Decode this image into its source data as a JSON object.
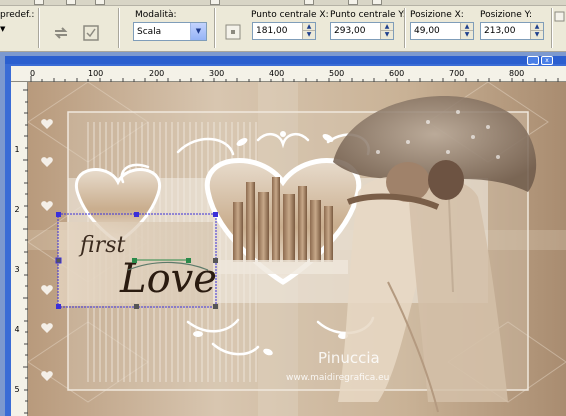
{
  "toolbar": {
    "preset_label": "predef.:",
    "mode_label": "Modalità:",
    "mode_value": "Scala",
    "center_x_label": "Punto centrale X:",
    "center_x_value": "181,00",
    "center_y_label": "Punto centrale Y:",
    "center_y_value": "293,00",
    "pos_x_label": "Posizione X:",
    "pos_x_value": "49,00",
    "pos_y_label": "Posizione Y:",
    "pos_y_value": "213,00"
  },
  "ruler": {
    "top_ticks": [
      "0",
      "100",
      "200",
      "300",
      "400",
      "500",
      "600",
      "700",
      "800"
    ],
    "left_ticks": [
      "1",
      "2",
      "3",
      "4",
      "5"
    ]
  },
  "canvas": {
    "text_first": "first",
    "text_love": "Love",
    "watermark_name": "Pinuccia",
    "watermark_url": "www.maidiregrafica.eu"
  },
  "colors": {
    "selection": "#3a2fd9",
    "workspace": "#7c99cf",
    "toolbar": "#ece9d8"
  }
}
